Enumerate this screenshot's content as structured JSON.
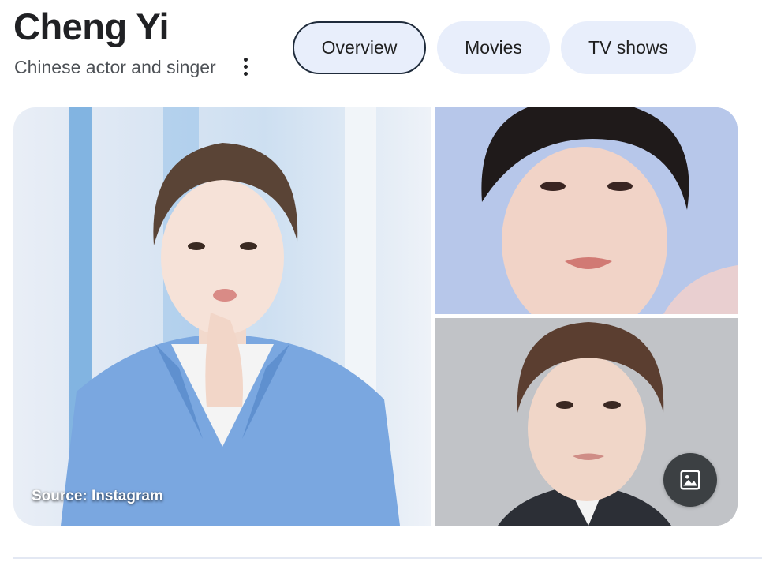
{
  "knowledge_panel": {
    "title": "Cheng Yi",
    "subtitle": "Chinese actor and singer",
    "more_icon": "more-vert-icon"
  },
  "tabs": [
    {
      "label": "Overview",
      "active": true
    },
    {
      "label": "Movies",
      "active": false
    },
    {
      "label": "TV shows",
      "active": false
    }
  ],
  "images": {
    "main_caption": "Source: Instagram",
    "gallery_icon": "image-gallery-icon"
  },
  "colors": {
    "tab_bg": "#e8eefb",
    "tab_active_border": "#1f2b3b",
    "gallery_button_bg": "#3c4043",
    "text_primary": "#202124",
    "text_secondary": "#4d5156"
  }
}
